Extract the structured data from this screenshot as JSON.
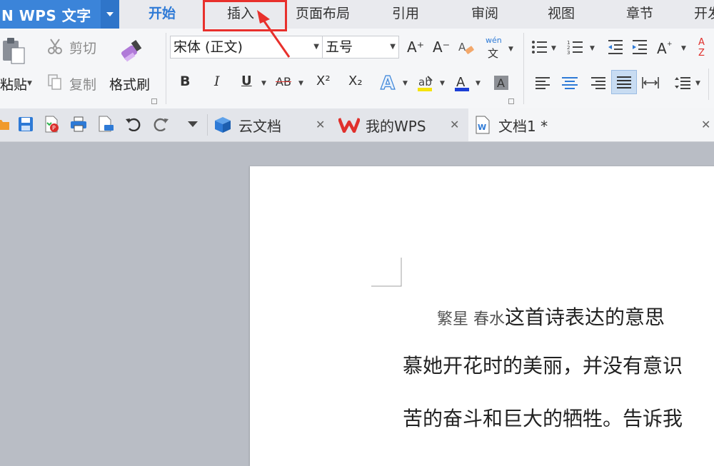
{
  "app": {
    "title": "N  WPS 文字"
  },
  "menu_tabs": [
    {
      "label": "开始",
      "active": true
    },
    {
      "label": "插入"
    },
    {
      "label": "页面布局"
    },
    {
      "label": "引用"
    },
    {
      "label": "审阅"
    },
    {
      "label": "视图"
    },
    {
      "label": "章节"
    },
    {
      "label": "开发"
    }
  ],
  "ribbon": {
    "paste_label": "粘贴",
    "cut_label": "剪切",
    "copy_label": "复制",
    "format_painter_label": "格式刷",
    "font_name": "宋体 (正文)",
    "font_size": "五号",
    "bold": "B",
    "italic": "I",
    "underline": "U",
    "strikethrough": "AB",
    "superscript": "X²",
    "subscript": "X₂",
    "phonetic": "wén",
    "grow_font": "A⁺",
    "shrink_font": "A⁻"
  },
  "doc_tabs": [
    {
      "label": "云文档"
    },
    {
      "label": "我的WPS"
    },
    {
      "label": "文档1 *"
    }
  ],
  "document": {
    "line1_sub": "繁星  春水",
    "line1_main": "这首诗表达的意思",
    "line2": "慕她开花时的美丽，并没有意识",
    "line3": "苦的奋斗和巨大的牺牲。告诉我"
  },
  "colors": {
    "accent": "#2e7ad6",
    "app_button": "#3b84d9",
    "highlight_box": "#e8302c"
  }
}
